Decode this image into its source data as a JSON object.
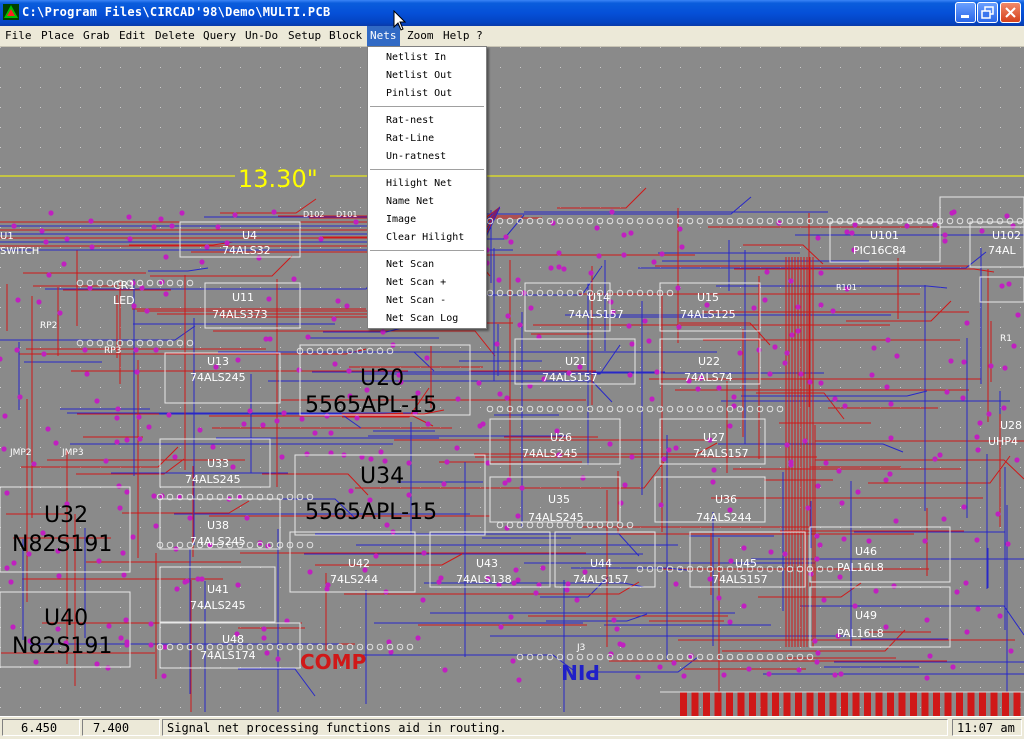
{
  "window": {
    "title": "C:\\Program Files\\CIRCAD'98\\Demo\\MULTI.PCB"
  },
  "menubar": {
    "items": [
      {
        "label": "File"
      },
      {
        "label": "Place"
      },
      {
        "label": "Grab"
      },
      {
        "label": "Edit"
      },
      {
        "label": "Delete"
      },
      {
        "label": "Query"
      },
      {
        "label": "Un-Do"
      },
      {
        "label": "Setup"
      },
      {
        "label": "Block"
      },
      {
        "label": "Nets"
      },
      {
        "label": "Zoom"
      },
      {
        "label": "Help ?"
      }
    ]
  },
  "nets_menu": {
    "groups": [
      [
        "Netlist In",
        "Netlist Out",
        "Pinlist Out"
      ],
      [
        "Rat-nest",
        "Rat-Line",
        "Un-ratnest"
      ],
      [
        "Hilight Net",
        "Name Net",
        "Image",
        "Clear Hilight"
      ],
      [
        "Net Scan",
        "Net Scan +",
        "Net Scan -",
        "Net Scan Log"
      ]
    ]
  },
  "board": {
    "dimension_label": "13.30\"",
    "components": [
      {
        "ref": "U1",
        "part": "SWITCH"
      },
      {
        "ref": "U4",
        "part": "74ALS32"
      },
      {
        "ref": "D102"
      },
      {
        "ref": "D101"
      },
      {
        "ref": "CR1",
        "part": "LED"
      },
      {
        "ref": "RP2"
      },
      {
        "ref": "RP3"
      },
      {
        "ref": "U11",
        "part": "74ALS373"
      },
      {
        "ref": "U13",
        "part": "74ALS245"
      },
      {
        "ref": "U14",
        "part": "74ALS157"
      },
      {
        "ref": "U15",
        "part": "74ALS125"
      },
      {
        "ref": "U101",
        "part": "PIC16C84"
      },
      {
        "ref": "U102",
        "part": "74AL"
      },
      {
        "ref": "R101"
      },
      {
        "ref": "R1"
      },
      {
        "ref": "U20",
        "part": "5565APL-15"
      },
      {
        "ref": "U21",
        "part": "74ALS157"
      },
      {
        "ref": "U22",
        "part": "74ALS74"
      },
      {
        "ref": "U26",
        "part": "74ALS245"
      },
      {
        "ref": "U27",
        "part": "74ALS157"
      },
      {
        "ref": "U28",
        "part": "UHP4"
      },
      {
        "ref": "U33",
        "part": "74ALS245"
      },
      {
        "ref": "U34",
        "part": "5565APL-15"
      },
      {
        "ref": "U35",
        "part": "74ALS245"
      },
      {
        "ref": "U36",
        "part": "74ALS244"
      },
      {
        "ref": "U32",
        "part": "N82S191"
      },
      {
        "ref": "U38",
        "part": "74ALS245"
      },
      {
        "ref": "U42",
        "part": "74LS244"
      },
      {
        "ref": "U43",
        "part": "74ALS138"
      },
      {
        "ref": "U44",
        "part": "74ALS157"
      },
      {
        "ref": "U45",
        "part": "74ALS157"
      },
      {
        "ref": "U46",
        "part": "PAL16L8"
      },
      {
        "ref": "U41",
        "part": "74ALS245"
      },
      {
        "ref": "U40",
        "part": "N82S191"
      },
      {
        "ref": "U48",
        "part": "74ALS174"
      },
      {
        "ref": "U49",
        "part": "PAL16L8"
      },
      {
        "ref": "JMP2"
      },
      {
        "ref": "JMP3"
      },
      {
        "ref": "J3"
      }
    ],
    "comp_label": "COMP",
    "pin_label": "PIN"
  },
  "statusbar": {
    "x_coord": "6.450",
    "y_coord": "7.400",
    "message": "Signal net processing functions aid in routing.",
    "clock": "11:07 am"
  },
  "colors": {
    "titlebar": "#0550d8",
    "menu_highlight": "#316ac5",
    "board_bg": "#8a8a8a",
    "trace_red": "#d01818",
    "trace_blue": "#2828c8",
    "pad_magenta": "#c020c0",
    "silk_white": "#ffffff",
    "dimension_yellow": "#ffff00"
  }
}
